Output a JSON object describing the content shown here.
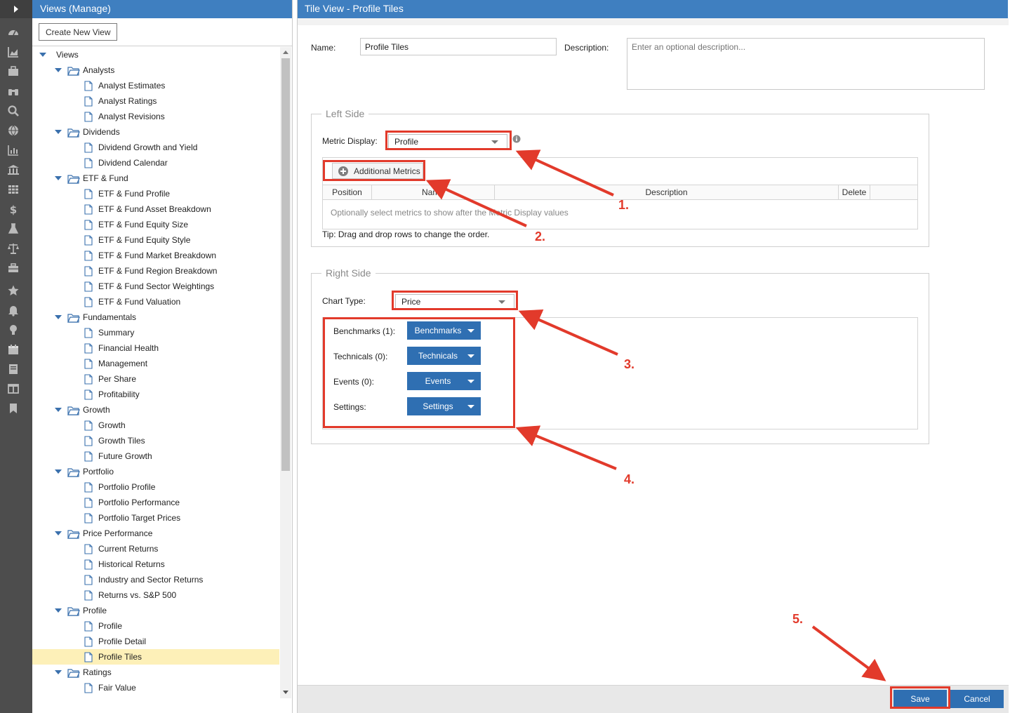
{
  "views_panel": {
    "title": "Views (Manage)",
    "create_button": "Create New View",
    "tree": [
      {
        "label": "Views",
        "level": 0,
        "kind": "root"
      },
      {
        "label": "Analysts",
        "level": 1,
        "kind": "folder"
      },
      {
        "label": "Analyst Estimates",
        "level": 2,
        "kind": "doc"
      },
      {
        "label": "Analyst Ratings",
        "level": 2,
        "kind": "doc"
      },
      {
        "label": "Analyst Revisions",
        "level": 2,
        "kind": "doc"
      },
      {
        "label": "Dividends",
        "level": 1,
        "kind": "folder"
      },
      {
        "label": "Dividend Growth and Yield",
        "level": 2,
        "kind": "doc"
      },
      {
        "label": "Dividend Calendar",
        "level": 2,
        "kind": "doc"
      },
      {
        "label": "ETF & Fund",
        "level": 1,
        "kind": "folder"
      },
      {
        "label": "ETF & Fund Profile",
        "level": 2,
        "kind": "doc"
      },
      {
        "label": "ETF & Fund Asset Breakdown",
        "level": 2,
        "kind": "doc"
      },
      {
        "label": "ETF & Fund Equity Size",
        "level": 2,
        "kind": "doc"
      },
      {
        "label": "ETF & Fund Equity Style",
        "level": 2,
        "kind": "doc"
      },
      {
        "label": "ETF & Fund Market Breakdown",
        "level": 2,
        "kind": "doc"
      },
      {
        "label": "ETF & Fund Region Breakdown",
        "level": 2,
        "kind": "doc"
      },
      {
        "label": "ETF & Fund Sector Weightings",
        "level": 2,
        "kind": "doc"
      },
      {
        "label": "ETF & Fund Valuation",
        "level": 2,
        "kind": "doc"
      },
      {
        "label": "Fundamentals",
        "level": 1,
        "kind": "folder"
      },
      {
        "label": "Summary",
        "level": 2,
        "kind": "doc"
      },
      {
        "label": "Financial Health",
        "level": 2,
        "kind": "doc"
      },
      {
        "label": "Management",
        "level": 2,
        "kind": "doc"
      },
      {
        "label": "Per Share",
        "level": 2,
        "kind": "doc"
      },
      {
        "label": "Profitability",
        "level": 2,
        "kind": "doc"
      },
      {
        "label": "Growth",
        "level": 1,
        "kind": "folder"
      },
      {
        "label": "Growth",
        "level": 2,
        "kind": "doc"
      },
      {
        "label": "Growth Tiles",
        "level": 2,
        "kind": "doc"
      },
      {
        "label": "Future Growth",
        "level": 2,
        "kind": "doc"
      },
      {
        "label": "Portfolio",
        "level": 1,
        "kind": "folder"
      },
      {
        "label": "Portfolio Profile",
        "level": 2,
        "kind": "doc"
      },
      {
        "label": "Portfolio Performance",
        "level": 2,
        "kind": "doc"
      },
      {
        "label": "Portfolio Target Prices",
        "level": 2,
        "kind": "doc"
      },
      {
        "label": "Price Performance",
        "level": 1,
        "kind": "folder"
      },
      {
        "label": "Current Returns",
        "level": 2,
        "kind": "doc"
      },
      {
        "label": "Historical Returns",
        "level": 2,
        "kind": "doc"
      },
      {
        "label": "Industry and Sector Returns",
        "level": 2,
        "kind": "doc"
      },
      {
        "label": "Returns vs. S&P 500",
        "level": 2,
        "kind": "doc"
      },
      {
        "label": "Profile",
        "level": 1,
        "kind": "folder"
      },
      {
        "label": "Profile",
        "level": 2,
        "kind": "doc"
      },
      {
        "label": "Profile Detail",
        "level": 2,
        "kind": "doc"
      },
      {
        "label": "Profile Tiles",
        "level": 2,
        "kind": "doc",
        "selected": true
      },
      {
        "label": "Ratings",
        "level": 1,
        "kind": "folder"
      },
      {
        "label": "Fair Value",
        "level": 2,
        "kind": "doc"
      }
    ]
  },
  "rail_icons": [
    "dashboard-icon",
    "area-chart-icon",
    "briefcase-icon",
    "binoculars-icon",
    "search-icon",
    "globe-icon",
    "bar-chart-icon",
    "bank-icon",
    "grid-icon",
    "dollar-icon",
    "flask-icon",
    "scale-icon",
    "toolbox-icon",
    "star-icon",
    "bell-icon",
    "lightbulb-icon",
    "calendar-icon",
    "book-icon",
    "columns-icon",
    "bookmark-icon"
  ],
  "main": {
    "title": "Tile View - Profile Tiles",
    "name_label": "Name:",
    "name_value": "Profile Tiles",
    "description_label": "Description:",
    "description_placeholder": "Enter an optional description...",
    "left_side": {
      "legend": "Left Side",
      "metric_label": "Metric Display:",
      "metric_value": "Profile",
      "additional_button": "Additional Metrics",
      "columns": [
        "Position",
        "Name",
        "Description",
        "Delete"
      ],
      "empty_text": "Optionally select metrics to show after the Metric Display values",
      "tip": "Tip: Drag and drop rows to change the order."
    },
    "right_side": {
      "legend": "Right Side",
      "chart_label": "Chart Type:",
      "chart_value": "Price",
      "rows": [
        {
          "label": "Benchmarks (1):",
          "button": "Benchmarks"
        },
        {
          "label": "Technicals (0):",
          "button": "Technicals"
        },
        {
          "label": "Events (0):",
          "button": "Events"
        },
        {
          "label": "Settings:",
          "button": "Settings"
        }
      ]
    },
    "save_button": "Save",
    "cancel_button": "Cancel"
  },
  "annotations": [
    "1.",
    "2.",
    "3.",
    "4.",
    "5."
  ],
  "colors": {
    "header": "#3f7fc0",
    "button": "#2f6fb2",
    "annotation": "#e23a2b",
    "selected_row": "#fdf0b8",
    "rail": "#4d4d4d"
  }
}
